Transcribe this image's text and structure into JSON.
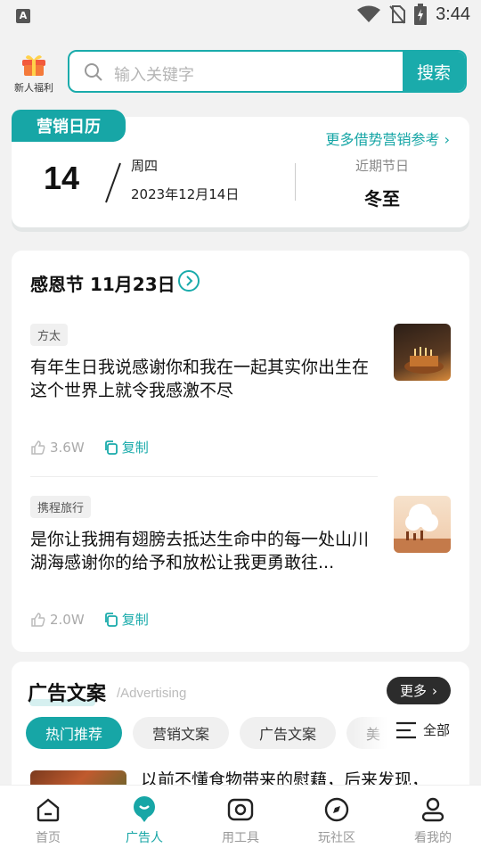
{
  "status_bar": {
    "time": "3:44",
    "app_badge": "A"
  },
  "header": {
    "gift_label": "新人福利",
    "search_placeholder": "输入关键字",
    "search_button": "搜索"
  },
  "calendar": {
    "tag": "营销日历",
    "more_link": "更多借势营销参考",
    "day": "14",
    "weekday": "周四",
    "date": "2023年12月14日",
    "recent_label": "近期节日",
    "recent_festival": "冬至"
  },
  "festival_section": {
    "title": "感恩节 11月23日",
    "items": [
      {
        "tag": "方太",
        "text": "有年生日我说感谢你和我在一起其实你出生在这个世界上就令我感激不尽",
        "likes": "3.6W",
        "copy": "复制"
      },
      {
        "tag": "携程旅行",
        "text": "是你让我拥有翅膀去抵达生命中的每一处山川湖海感谢你的给予和放松让我更勇敢往...",
        "likes": "2.0W",
        "copy": "复制"
      }
    ]
  },
  "ad_section": {
    "title": "广告文案",
    "subtitle": "/Advertising",
    "more": "更多",
    "chips": [
      "热门推荐",
      "营销文案",
      "广告文案",
      "美"
    ],
    "all_label": "全部",
    "preview_text": "以前不懂食物带来的慰藉，后来发现，"
  },
  "tabbar": [
    {
      "label": "首页",
      "icon": "home-icon"
    },
    {
      "label": "广告人",
      "icon": "pin-icon"
    },
    {
      "label": "用工具",
      "icon": "camera-icon"
    },
    {
      "label": "玩社区",
      "icon": "compass-icon"
    },
    {
      "label": "看我的",
      "icon": "person-icon"
    }
  ],
  "colors": {
    "accent": "#17a6a6",
    "search_border": "#1aabab"
  }
}
